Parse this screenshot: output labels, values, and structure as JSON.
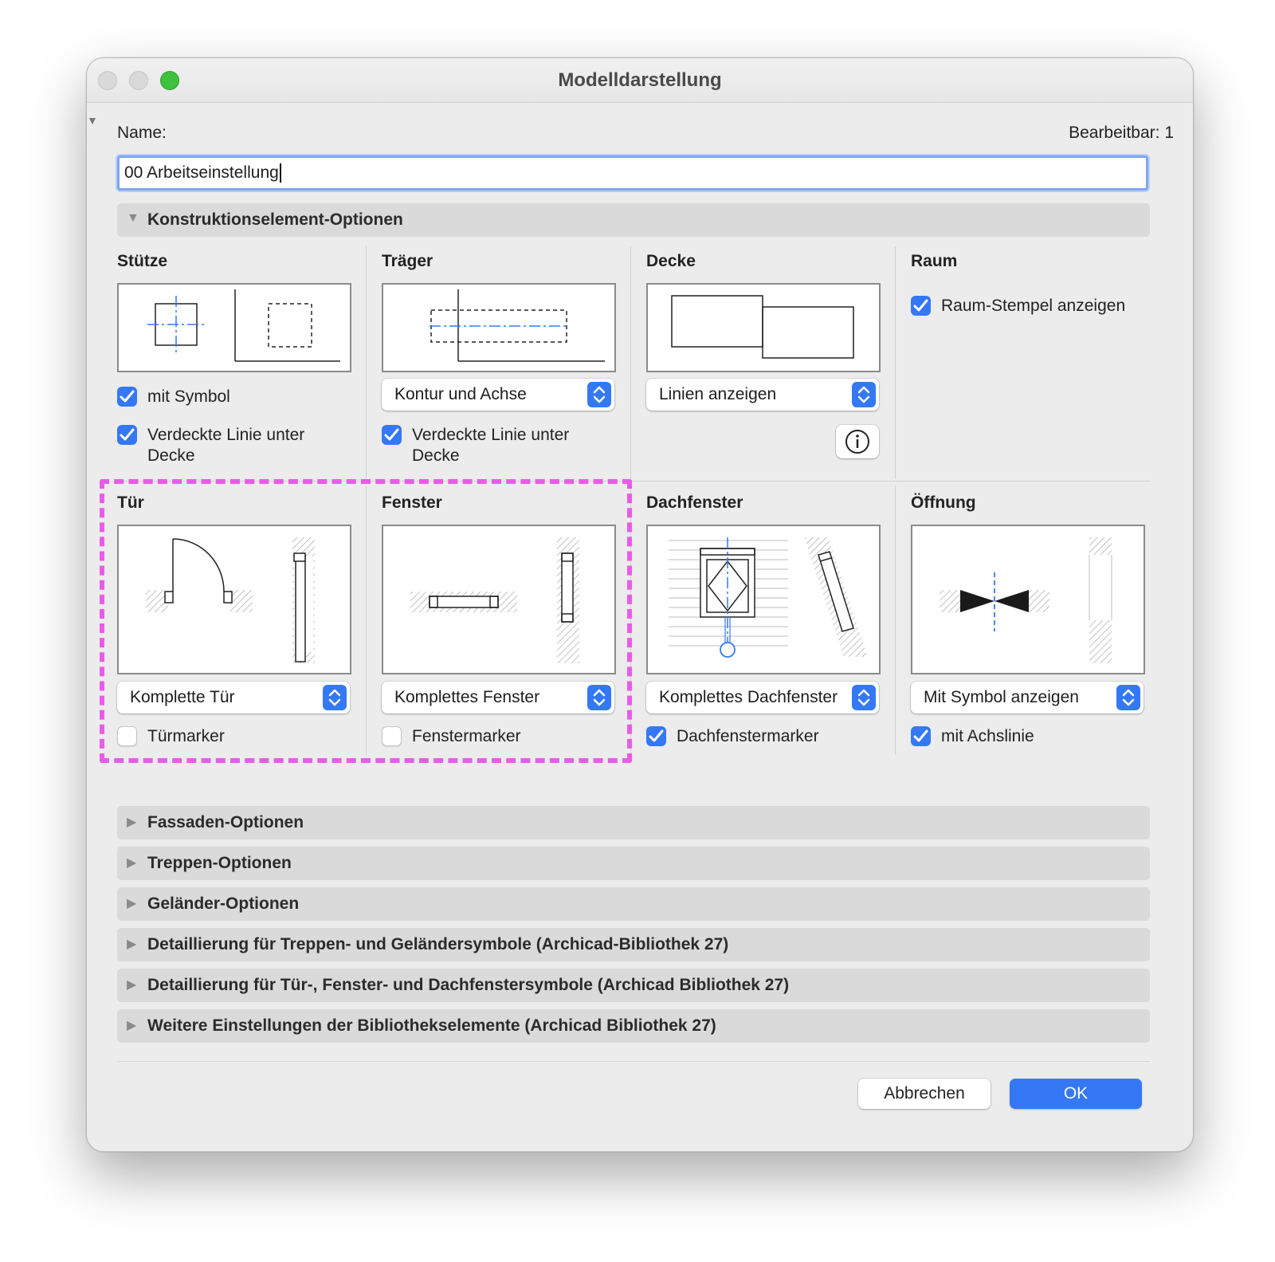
{
  "window": {
    "title": "Modelldarstellung"
  },
  "name": {
    "label": "Name:",
    "value": "00 Arbeitseinstellung",
    "editable_label": "Bearbeitbar: 1"
  },
  "construction_section": {
    "label": "Konstruktionselement-Optionen"
  },
  "stuetze": {
    "heading": "Stütze",
    "symbol_checkbox": {
      "label": "mit Symbol",
      "checked": true
    },
    "hidden_line_checkbox": {
      "label_line1": "Verdeckte Linie unter",
      "label_line2": "Decke",
      "checked": true
    }
  },
  "traeger": {
    "heading": "Träger",
    "select": "Kontur und Achse",
    "hidden_line_checkbox": {
      "label_line1": "Verdeckte Linie unter",
      "label_line2": "Decke",
      "checked": true
    }
  },
  "decke": {
    "heading": "Decke",
    "select": "Linien anzeigen"
  },
  "raum": {
    "heading": "Raum",
    "stamp_checkbox": {
      "label": "Raum-Stempel anzeigen",
      "checked": true
    }
  },
  "tuer": {
    "heading": "Tür",
    "select": "Komplette Tür",
    "marker_checkbox": {
      "label": "Türmarker",
      "checked": false
    }
  },
  "fenster": {
    "heading": "Fenster",
    "select": "Komplettes Fenster",
    "marker_checkbox": {
      "label": "Fenstermarker",
      "checked": false
    }
  },
  "dachfenster": {
    "heading": "Dachfenster",
    "select": "Komplettes Dachfenster",
    "marker_checkbox": {
      "label": "Dachfenstermarker",
      "checked": true
    }
  },
  "oeffnung": {
    "heading": "Öffnung",
    "select": "Mit Symbol anzeigen",
    "axis_checkbox": {
      "label": "mit Achslinie",
      "checked": true
    }
  },
  "sections": [
    {
      "label": "Fassaden-Optionen"
    },
    {
      "label": "Treppen-Optionen"
    },
    {
      "label": "Geländer-Optionen"
    },
    {
      "label": "Detaillierung für Treppen- und Geländersymbole (Archicad-Bibliothek 27)"
    },
    {
      "label": "Detaillierung für Tür-, Fenster- und Dachfenstersymbole (Archicad Bibliothek 27)"
    },
    {
      "label": "Weitere Einstellungen der Bibliothekselemente (Archicad Bibliothek 27)"
    }
  ],
  "buttons": {
    "cancel": "Abbrechen",
    "ok": "OK"
  },
  "colors": {
    "accent": "#3478f6",
    "highlight": "#e95ce8",
    "zoom_button": "#3dc13f"
  }
}
